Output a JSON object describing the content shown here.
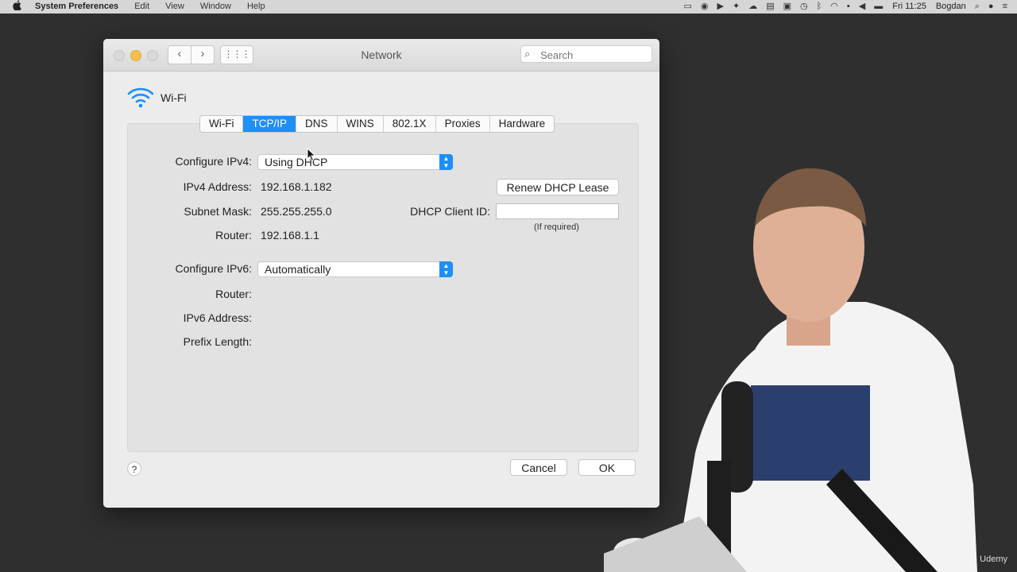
{
  "menubar": {
    "apple": "",
    "app_name": "System Preferences",
    "menus": [
      "Edit",
      "View",
      "Window",
      "Help"
    ],
    "clock": "Fri 11:25",
    "user": "Bogdan"
  },
  "window": {
    "title": "Network",
    "search_placeholder": "Search",
    "nav_back": "‹",
    "nav_forward": "›",
    "grid": "⋮⋮⋮"
  },
  "interface": {
    "name": "Wi-Fi"
  },
  "tabs": [
    {
      "label": "Wi-Fi",
      "active": false
    },
    {
      "label": "TCP/IP",
      "active": true
    },
    {
      "label": "DNS",
      "active": false
    },
    {
      "label": "WINS",
      "active": false
    },
    {
      "label": "802.1X",
      "active": false
    },
    {
      "label": "Proxies",
      "active": false
    },
    {
      "label": "Hardware",
      "active": false
    }
  ],
  "ipv4": {
    "configure_label": "Configure IPv4:",
    "configure_value": "Using DHCP",
    "address_label": "IPv4 Address:",
    "address_value": "192.168.1.182",
    "subnet_label": "Subnet Mask:",
    "subnet_value": "255.255.255.0",
    "router_label": "Router:",
    "router_value": "192.168.1.1"
  },
  "dhcp": {
    "renew_label": "Renew DHCP Lease",
    "client_id_label": "DHCP Client ID:",
    "client_id_value": "",
    "client_id_note": "(If required)"
  },
  "ipv6": {
    "configure_label": "Configure IPv6:",
    "configure_value": "Automatically",
    "router_label": "Router:",
    "address_label": "IPv6 Address:",
    "prefix_label": "Prefix Length:"
  },
  "footer": {
    "help": "?",
    "cancel_label": "Cancel",
    "ok_label": "OK"
  },
  "watermark": "Udemy",
  "colors": {
    "accent": "#1e8ef9",
    "window_bg": "#ececec",
    "desktop": "#2f2f2f"
  }
}
